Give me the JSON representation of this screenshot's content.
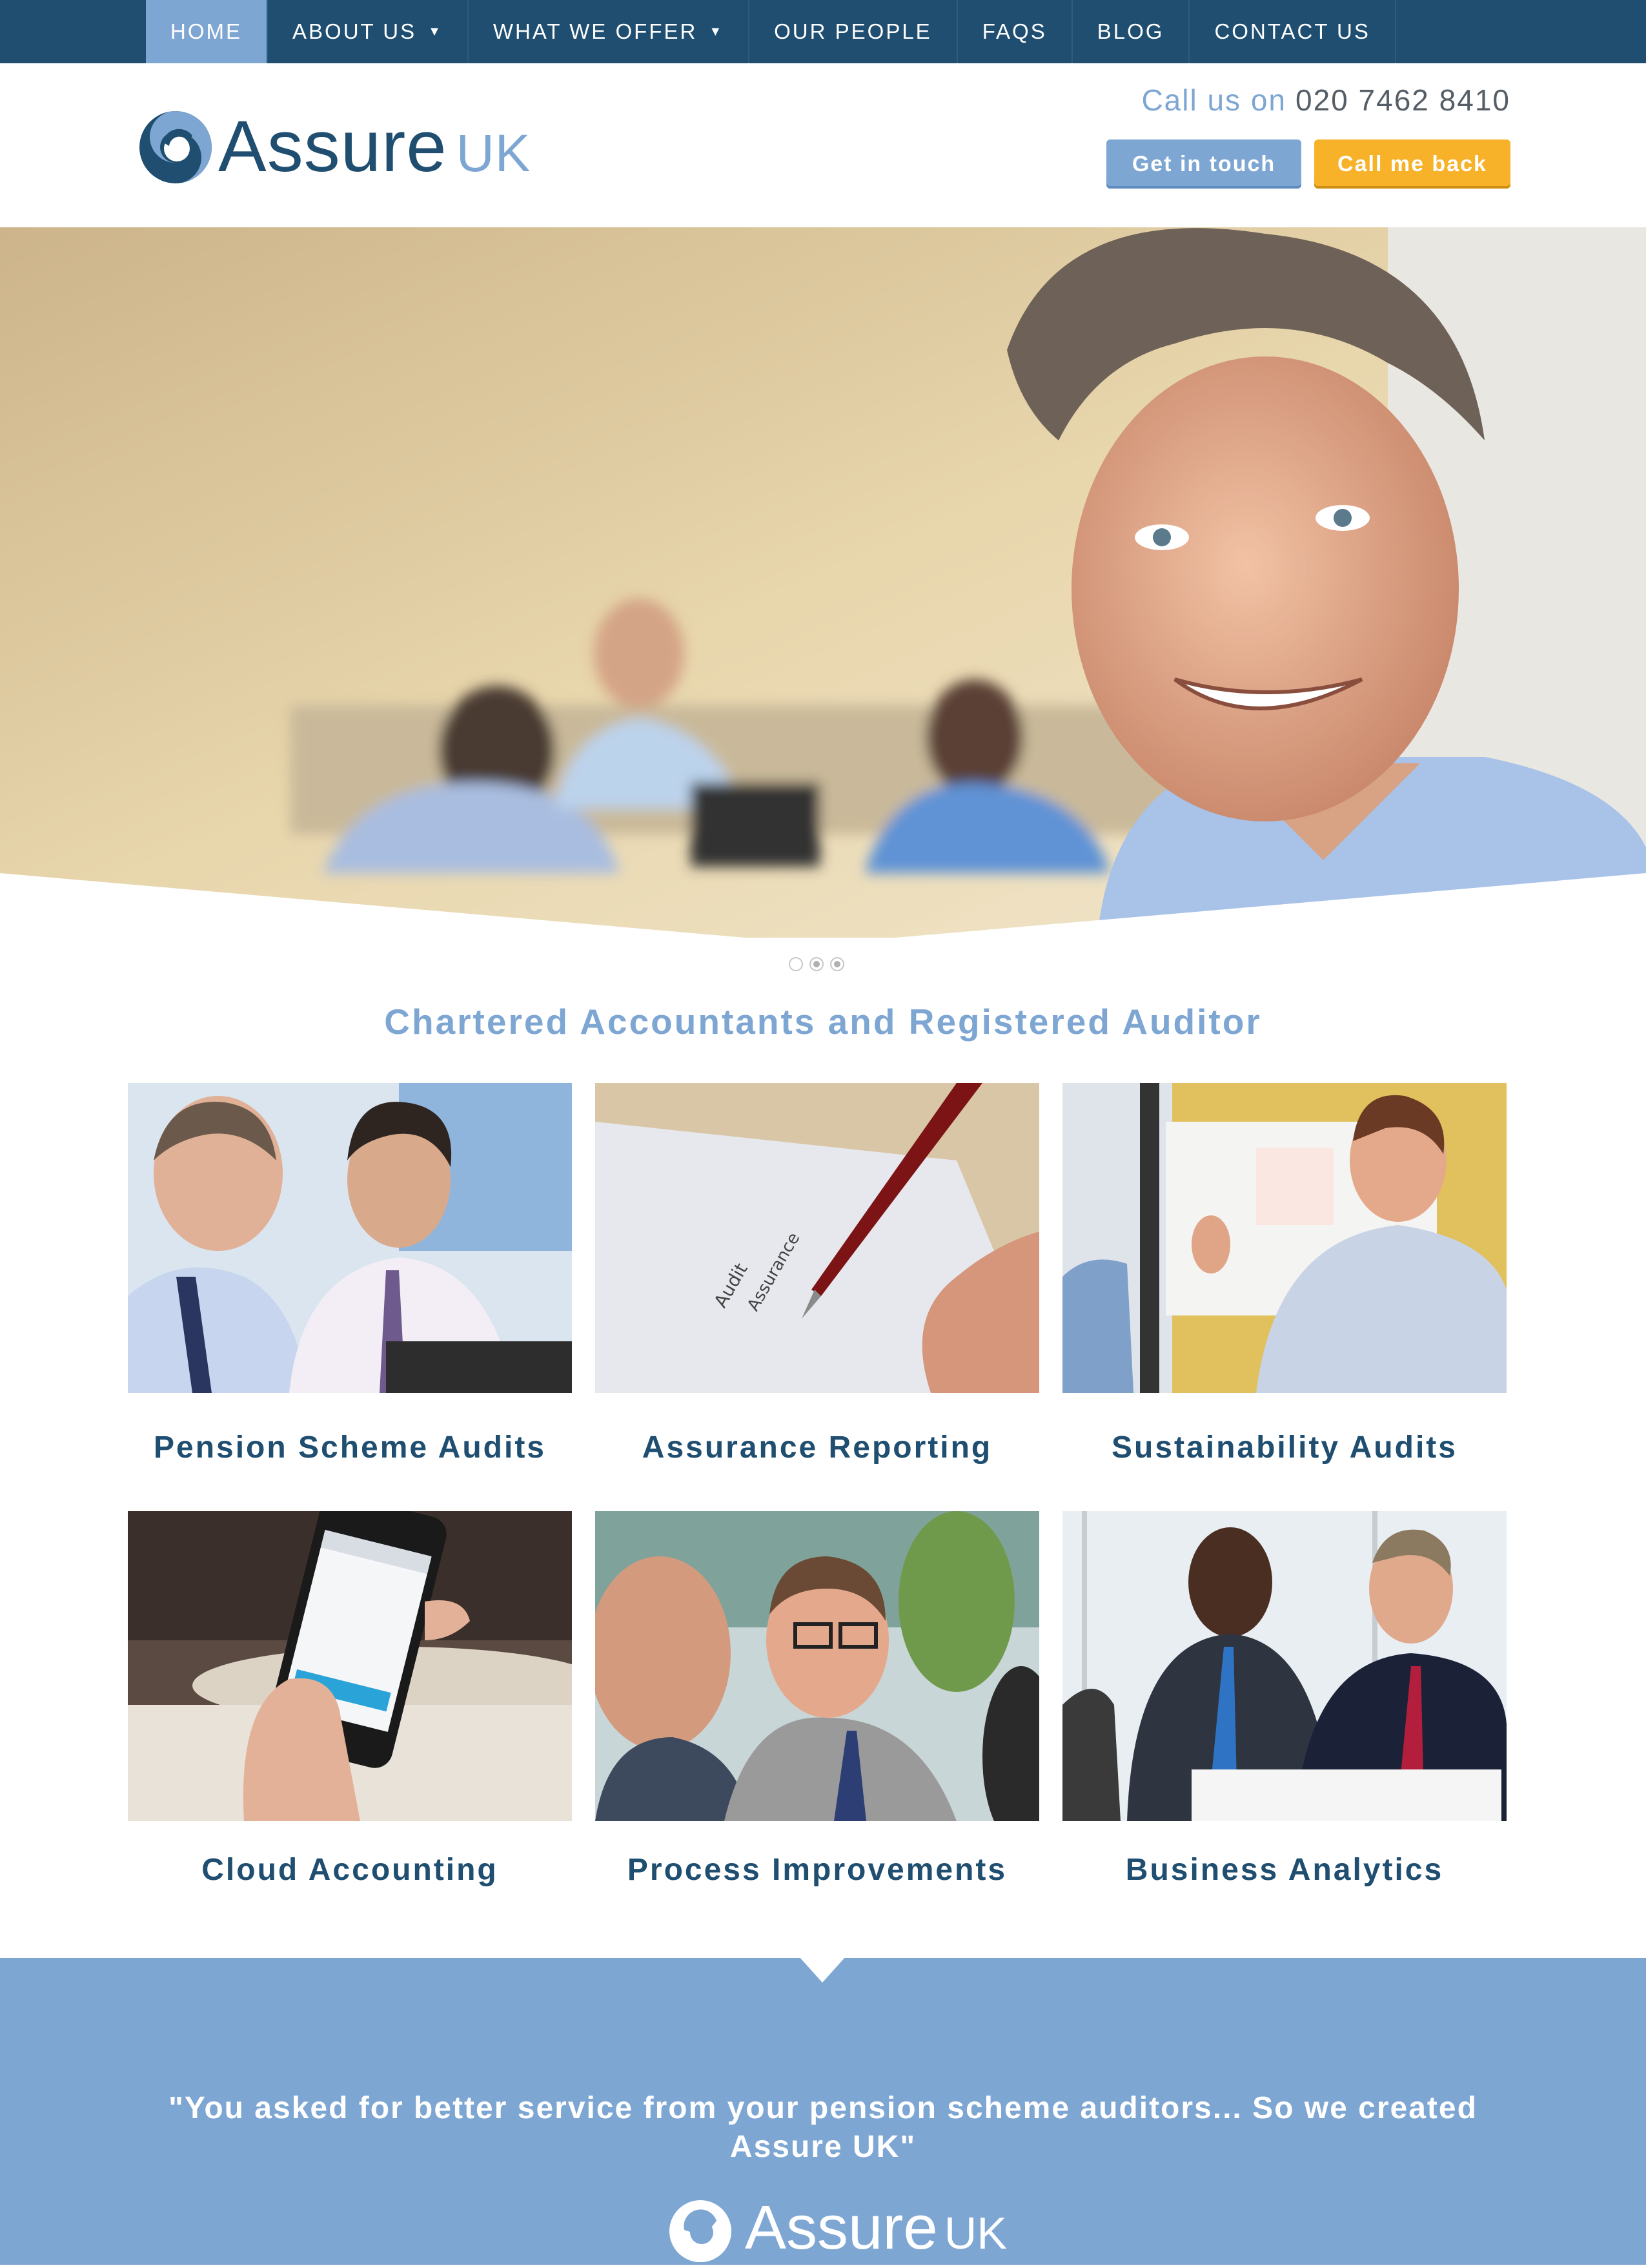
{
  "nav": {
    "items": [
      {
        "label": "HOME",
        "active": true,
        "dropdown": false
      },
      {
        "label": "ABOUT US",
        "active": false,
        "dropdown": true
      },
      {
        "label": "WHAT WE OFFER",
        "active": false,
        "dropdown": true
      },
      {
        "label": "OUR PEOPLE",
        "active": false,
        "dropdown": false
      },
      {
        "label": "FAQS",
        "active": false,
        "dropdown": false
      },
      {
        "label": "BLOG",
        "active": false,
        "dropdown": false
      },
      {
        "label": "CONTACT US",
        "active": false,
        "dropdown": false
      }
    ]
  },
  "header": {
    "logo_main": "Assure",
    "logo_suffix": "UK",
    "call_label": "Call us on",
    "call_number": "020 7462 8410",
    "get_in_touch_label": "Get in touch",
    "call_me_back_label": "Call me back"
  },
  "slider": {
    "dots": 3,
    "active_index": 1
  },
  "tagline": "Chartered Accountants and Registered Auditor",
  "services": [
    {
      "title": "Pension Scheme Audits"
    },
    {
      "title": "Assurance Reporting"
    },
    {
      "title": "Sustainability Audits"
    },
    {
      "title": "Cloud Accounting"
    },
    {
      "title": "Process Improvements"
    },
    {
      "title": "Business Analytics"
    }
  ],
  "quote": {
    "text": "\"You asked for better service from your pension scheme auditors... So we created Assure UK\""
  },
  "footer_logo": {
    "main": "Assure",
    "suffix": "UK"
  },
  "colors": {
    "navy": "#1f4e70",
    "light_blue": "#7ea6d3",
    "orange": "#f8b229"
  }
}
